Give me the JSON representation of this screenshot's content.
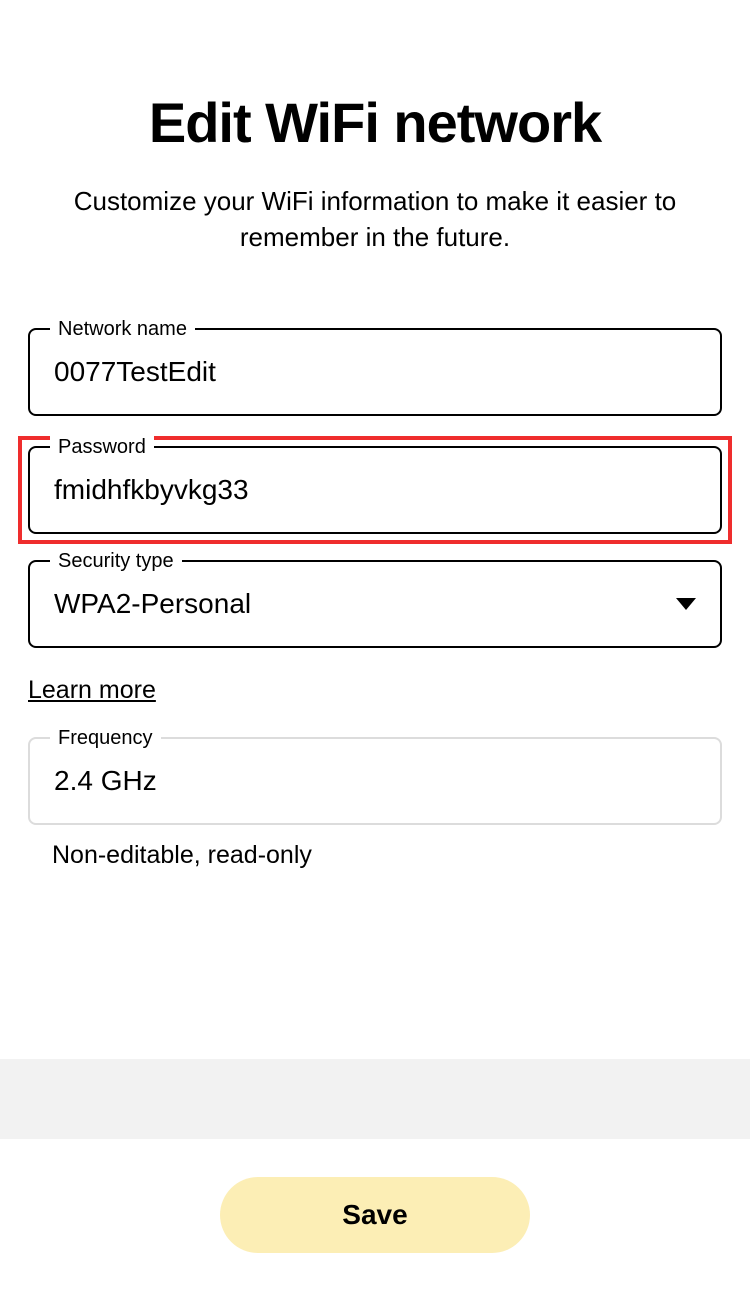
{
  "header": {
    "title": "Edit WiFi network",
    "subtitle": "Customize your WiFi information to make it easier to remember in the future."
  },
  "form": {
    "networkName": {
      "label": "Network name",
      "value": "0077TestEdit"
    },
    "password": {
      "label": "Password",
      "value": "fmidhfkbyvkg33"
    },
    "securityType": {
      "label": "Security type",
      "value": "WPA2-Personal"
    },
    "learnMore": "Learn more",
    "frequency": {
      "label": "Frequency",
      "value": "2.4 GHz",
      "helper": "Non-editable, read-only"
    }
  },
  "actions": {
    "save": "Save"
  }
}
